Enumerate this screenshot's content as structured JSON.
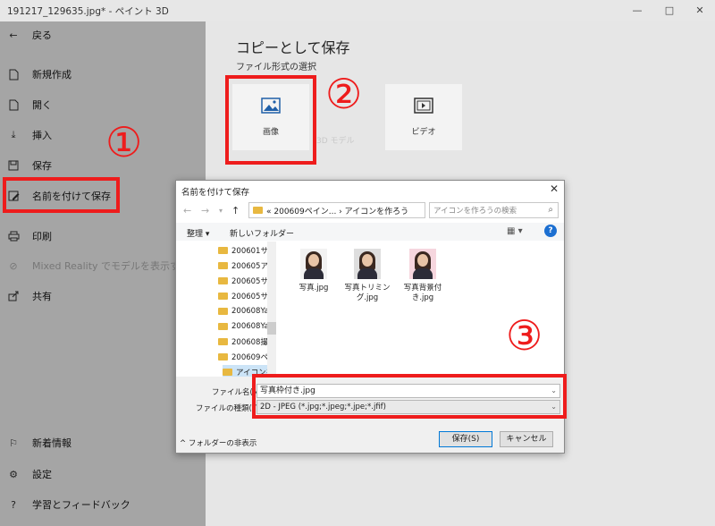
{
  "window": {
    "title": "191217_129635.jpg* - ペイント 3D",
    "minimize": "—",
    "maximize": "□",
    "close": "✕"
  },
  "sidebar": {
    "back_label": "戻る",
    "items": [
      {
        "label": "新規作成",
        "icon": "new-file-icon"
      },
      {
        "label": "開く",
        "icon": "open-file-icon"
      },
      {
        "label": "挿入",
        "icon": "insert-icon"
      },
      {
        "label": "保存",
        "icon": "save-icon"
      },
      {
        "label": "名前を付けて保存",
        "icon": "save-as-icon"
      },
      {
        "label": "印刷",
        "icon": "print-icon"
      },
      {
        "label": "Mixed Reality でモデルを表示する",
        "icon": "mixed-reality-icon"
      },
      {
        "label": "共有",
        "icon": "share-icon"
      }
    ],
    "bottom_items": [
      {
        "label": "新着情報",
        "icon": "flag-icon"
      },
      {
        "label": "設定",
        "icon": "gear-icon"
      },
      {
        "label": "学習とフィードバック",
        "icon": "help-icon"
      }
    ]
  },
  "main": {
    "title": "コピーとして保存",
    "subtitle": "ファイル形式の選択",
    "formats": [
      {
        "label": "画像",
        "icon": "image-icon"
      },
      {
        "label": "3D モデル",
        "icon": "3d-icon"
      },
      {
        "label": "ビデオ",
        "icon": "video-icon"
      }
    ]
  },
  "annotations": {
    "step1": "①",
    "step2": "②",
    "step3": "③",
    "color": "#ee1c1c"
  },
  "dialog": {
    "title": "名前を付けて保存",
    "address": "« 200609ペイン... › アイコンを作ろう",
    "search_placeholder": "アイコンを作ろうの検索",
    "organize": "整理 ▾",
    "new_folder": "新しいフォルダー",
    "tree": [
      "200601サイ",
      "200605アイ",
      "200605サイ",
      "200605サイ",
      "200608Yar",
      "200608Yar",
      "200608撮影",
      "200609ペイ",
      "アイコンを"
    ],
    "files": [
      "写真.jpg",
      "写真トリミング.jpg",
      "写真背景付き.jpg"
    ],
    "filename_label": "ファイル名(N):",
    "filename_value": "写真枠付き.jpg",
    "filetype_label": "ファイルの種類(T):",
    "filetype_value": "2D - JPEG (*.jpg;*.jpeg;*.jpe;*.jfif)",
    "hide_folders": "フォルダーの非表示",
    "save_button": "保存(S)",
    "cancel_button": "キャンセル"
  }
}
